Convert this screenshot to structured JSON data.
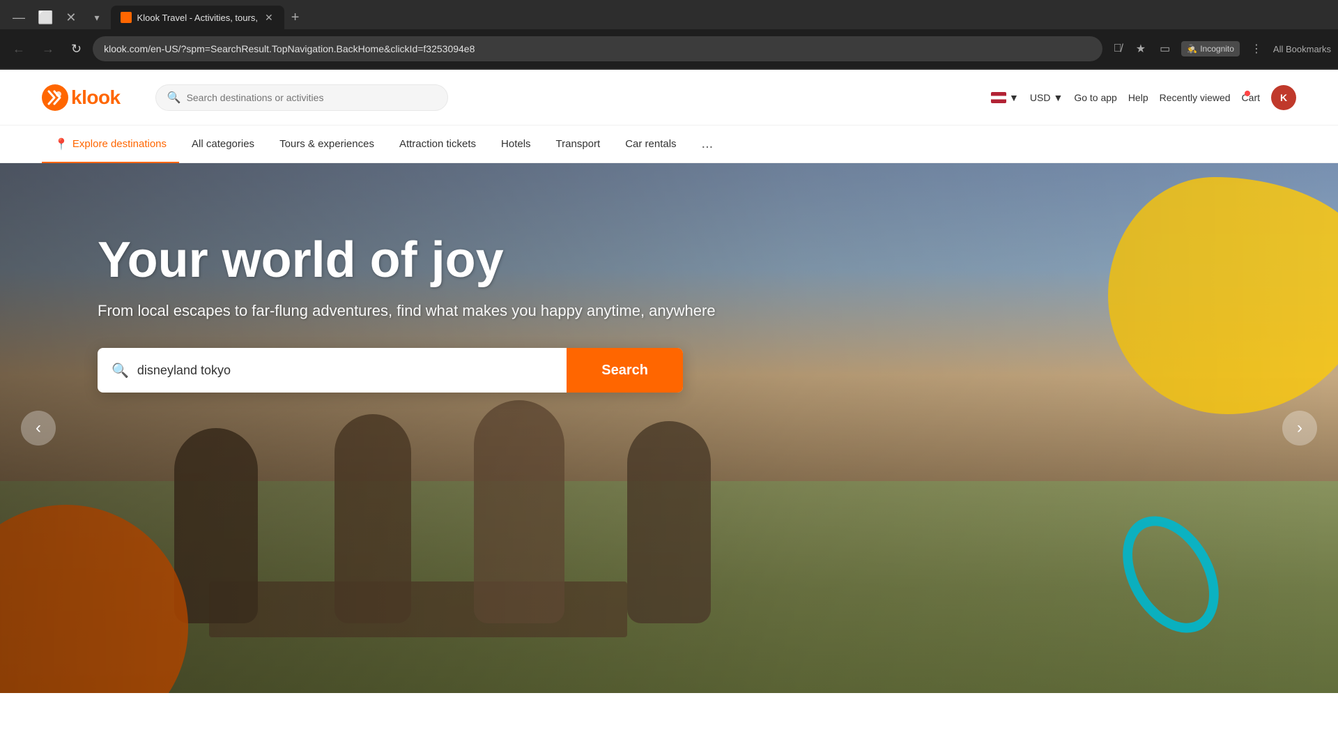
{
  "browser": {
    "tab_title": "Klook Travel - Activities, tours,",
    "url": "klook.com/en-US/?spm=SearchResult.TopNavigation.BackHome&clickId=f3253094e8",
    "new_tab_label": "+",
    "back_btn": "←",
    "forward_btn": "→",
    "refresh_btn": "↻",
    "incognito_label": "Incognito",
    "bookmarks_label": "All Bookmarks"
  },
  "header": {
    "logo_text": "klook",
    "search_placeholder": "Search destinations or activities",
    "lang_label": "USD",
    "currency_label": "USD",
    "goto_app_label": "Go to app",
    "help_label": "Help",
    "recently_viewed_label": "Recently viewed",
    "cart_label": "Cart"
  },
  "nav": {
    "items": [
      {
        "id": "explore",
        "label": "Explore destinations",
        "has_icon": true
      },
      {
        "id": "categories",
        "label": "All categories",
        "has_icon": false
      },
      {
        "id": "tours",
        "label": "Tours & experiences",
        "has_icon": false
      },
      {
        "id": "attraction",
        "label": "Attraction tickets",
        "has_icon": false
      },
      {
        "id": "hotels",
        "label": "Hotels",
        "has_icon": false
      },
      {
        "id": "transport",
        "label": "Transport",
        "has_icon": false
      },
      {
        "id": "car",
        "label": "Car rentals",
        "has_icon": false
      },
      {
        "id": "more",
        "label": "...",
        "has_icon": false
      }
    ]
  },
  "hero": {
    "title": "Your world of joy",
    "subtitle": "From local escapes to far-flung adventures, find what makes you happy anytime, anywhere",
    "search_placeholder": "disneyland tokyo",
    "search_btn_label": "Search",
    "arrow_prev": "‹",
    "arrow_next": "›"
  }
}
